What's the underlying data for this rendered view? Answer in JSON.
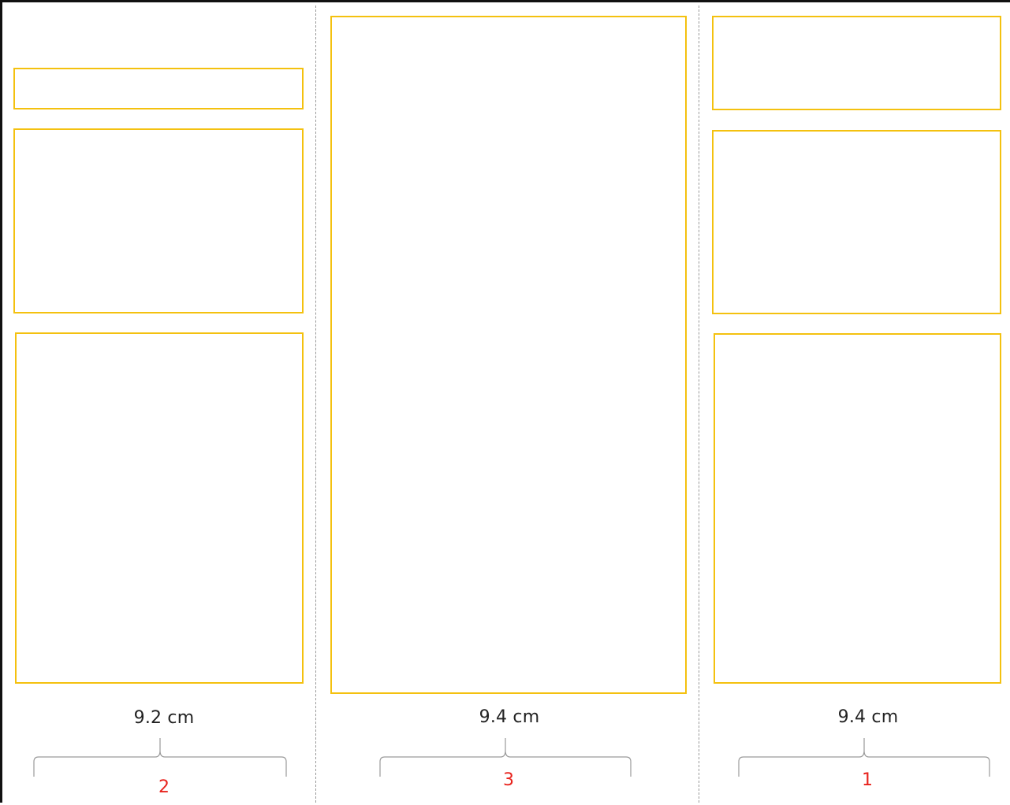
{
  "panels": [
    {
      "id": "panel-2",
      "width_label": "9.2 cm",
      "page_number": "2"
    },
    {
      "id": "panel-3",
      "width_label": "9.4 cm",
      "page_number": "3"
    },
    {
      "id": "panel-1",
      "width_label": "9.4 cm",
      "page_number": "1"
    }
  ],
  "colors": {
    "placeholder_border": "#f4c10f",
    "fold_line": "#9a9a9a",
    "page_number": "#e8231d",
    "brace": "#9a9a9a"
  }
}
